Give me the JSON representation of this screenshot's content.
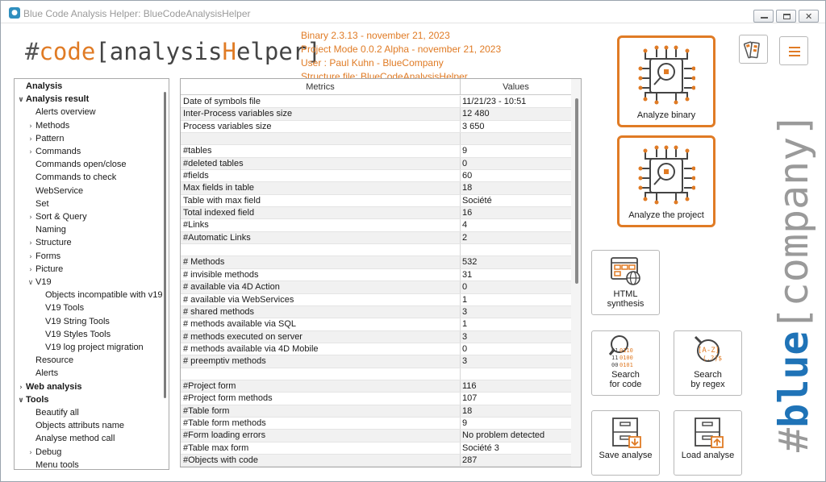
{
  "window": {
    "title": "Blue Code Analysis Helper: BlueCodeAnalysisHelper",
    "icon": "app-icon",
    "controls": [
      "minimize-icon",
      "maximize-icon",
      "close-icon"
    ]
  },
  "logo": {
    "hash": "#",
    "code": "code",
    "open": "[",
    "analysis": "analysis",
    "h": "H",
    "elper": "elper",
    "close": "]"
  },
  "info": {
    "binary": "Binary 2.3.13 - november 21, 2023",
    "project_mode": "Project Mode 0.0.2 Alpha - november 21, 2023",
    "user": "User : Paul Kuhn - BlueCompany",
    "structure": "Structure file: BlueCodeAnalysisHelper"
  },
  "tree": [
    {
      "label": "Analysis",
      "level": 0,
      "bold": true,
      "chevron": ""
    },
    {
      "label": "Analysis result",
      "level": 0,
      "bold": true,
      "chevron": "v"
    },
    {
      "label": "Alerts overview",
      "level": 1,
      "bold": false,
      "chevron": ""
    },
    {
      "label": "Methods",
      "level": 1,
      "bold": false,
      "chevron": ">"
    },
    {
      "label": "Pattern",
      "level": 1,
      "bold": false,
      "chevron": ">"
    },
    {
      "label": "Commands",
      "level": 1,
      "bold": false,
      "chevron": ">"
    },
    {
      "label": "Commands open/close",
      "level": 1,
      "bold": false,
      "chevron": ""
    },
    {
      "label": "Commands to check",
      "level": 1,
      "bold": false,
      "chevron": ""
    },
    {
      "label": "WebService",
      "level": 1,
      "bold": false,
      "chevron": ""
    },
    {
      "label": "Set",
      "level": 1,
      "bold": false,
      "chevron": ""
    },
    {
      "label": "Sort & Query",
      "level": 1,
      "bold": false,
      "chevron": ">"
    },
    {
      "label": "Naming",
      "level": 1,
      "bold": false,
      "chevron": ""
    },
    {
      "label": "Structure",
      "level": 1,
      "bold": false,
      "chevron": ">"
    },
    {
      "label": "Forms",
      "level": 1,
      "bold": false,
      "chevron": ">"
    },
    {
      "label": "Picture",
      "level": 1,
      "bold": false,
      "chevron": ">"
    },
    {
      "label": "V19",
      "level": 1,
      "bold": false,
      "chevron": "v"
    },
    {
      "label": "Objects incompatible with v19",
      "level": 2,
      "bold": false,
      "chevron": ""
    },
    {
      "label": "V19 Tools",
      "level": 2,
      "bold": false,
      "chevron": ""
    },
    {
      "label": "V19 String Tools",
      "level": 2,
      "bold": false,
      "chevron": ""
    },
    {
      "label": "V19 Styles Tools",
      "level": 2,
      "bold": false,
      "chevron": ""
    },
    {
      "label": "V19 log project migration",
      "level": 2,
      "bold": false,
      "chevron": ""
    },
    {
      "label": "Resource",
      "level": 1,
      "bold": false,
      "chevron": ""
    },
    {
      "label": "Alerts",
      "level": 1,
      "bold": false,
      "chevron": ""
    },
    {
      "label": "Web analysis",
      "level": 0,
      "bold": true,
      "chevron": ">"
    },
    {
      "label": "Tools",
      "level": 0,
      "bold": true,
      "chevron": "v"
    },
    {
      "label": "Beautify all",
      "level": 1,
      "bold": false,
      "chevron": ""
    },
    {
      "label": "Objects attributs name",
      "level": 1,
      "bold": false,
      "chevron": ""
    },
    {
      "label": "Analyse method call",
      "level": 1,
      "bold": false,
      "chevron": ""
    },
    {
      "label": "Debug",
      "level": 1,
      "bold": false,
      "chevron": ">"
    },
    {
      "label": "Menu tools",
      "level": 1,
      "bold": false,
      "chevron": ""
    }
  ],
  "table": {
    "headers": {
      "metrics": "Metrics",
      "values": "Values"
    },
    "rows": [
      {
        "metric": "Date of symbols file",
        "value": "11/21/23 - 10:51"
      },
      {
        "metric": "Inter-Process variables size",
        "value": "12 480"
      },
      {
        "metric": "Process variables size",
        "value": "3 650"
      },
      {
        "metric": "",
        "value": ""
      },
      {
        "metric": "#tables",
        "value": "9"
      },
      {
        "metric": "#deleted tables",
        "value": "0"
      },
      {
        "metric": "#fields",
        "value": "60"
      },
      {
        "metric": "Max fields in table",
        "value": "18"
      },
      {
        "metric": "Table with max field",
        "value": "Société"
      },
      {
        "metric": "Total indexed field",
        "value": "16"
      },
      {
        "metric": "#Links",
        "value": "4"
      },
      {
        "metric": "#Automatic Links",
        "value": "2"
      },
      {
        "metric": "",
        "value": ""
      },
      {
        "metric": "# Methods",
        "value": "532"
      },
      {
        "metric": "# invisible methods",
        "value": "31"
      },
      {
        "metric": "# available via 4D Action",
        "value": "0"
      },
      {
        "metric": "# available via WebServices",
        "value": "1"
      },
      {
        "metric": "# shared methods",
        "value": "3"
      },
      {
        "metric": "# methods available via SQL",
        "value": "1"
      },
      {
        "metric": "# methods executed on server",
        "value": "3"
      },
      {
        "metric": "# methods available via 4D Mobile",
        "value": "0"
      },
      {
        "metric": "# preemptiv methods",
        "value": "3"
      },
      {
        "metric": "",
        "value": ""
      },
      {
        "metric": "#Project form",
        "value": "116"
      },
      {
        "metric": "#Project form methods",
        "value": "107"
      },
      {
        "metric": "#Table form",
        "value": "18"
      },
      {
        "metric": "#Table form methods",
        "value": "9"
      },
      {
        "metric": "#Form loading errors",
        "value": "No problem detected"
      },
      {
        "metric": "#Table max form",
        "value": "Société 3"
      },
      {
        "metric": "#Objects with code",
        "value": "287"
      }
    ]
  },
  "actions": {
    "analyze_binary": "Analyze binary",
    "analyze_project": "Analyze the project",
    "html_synthesis_1": "HTML",
    "html_synthesis_2": "synthesis",
    "search_code_1": "Search",
    "search_code_2": "for code",
    "search_regex_1": "Search",
    "search_regex_2": "by regex",
    "save_analyse": "Save analyse",
    "load_analyse": "Load analyse"
  },
  "brand": {
    "hash": "#",
    "blue": "blue",
    "open": "[",
    "company": "company",
    "close": "]"
  },
  "colors": {
    "accent_orange": "#e07b25",
    "brand_blue": "#1f73b7",
    "brand_gray": "#9a9a9a"
  },
  "icons": {
    "settings": "palette-settings-icon",
    "menu": "hamburger-menu-icon"
  }
}
